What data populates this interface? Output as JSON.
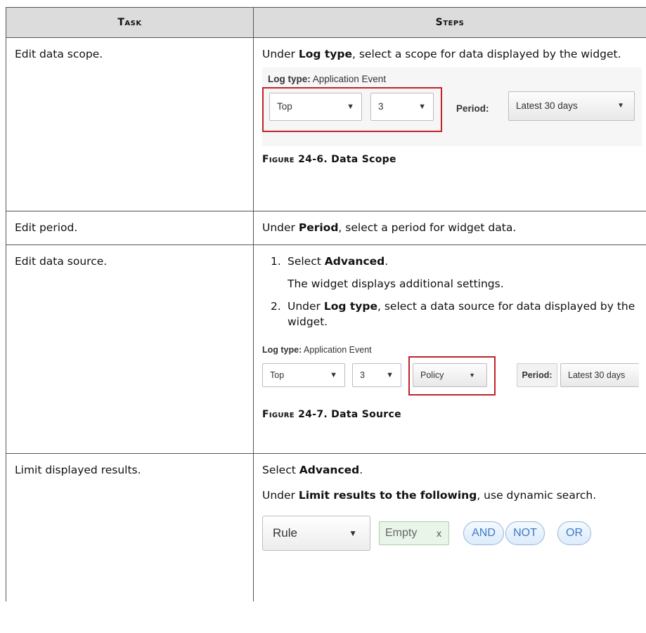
{
  "table": {
    "headers": [
      "Task",
      "Steps"
    ],
    "rows": {
      "r1": {
        "task": "Edit data scope.",
        "steps_pre": "Under ",
        "steps_bold": "Log type",
        "steps_post": ", select a scope for data displayed by the widget.",
        "figure": {
          "log_type_label": "Log type:",
          "log_type_value": " Application Event",
          "select1": "Top",
          "select2": "3",
          "period_label": "Period:",
          "period_value": "Latest 30 days",
          "caption_prefix": "Figure ",
          "caption_num": "24-6. Data Scope"
        }
      },
      "r2": {
        "task": "Edit period.",
        "steps_pre": "Under ",
        "steps_bold": "Period",
        "steps_post": ", select a period for widget data."
      },
      "r3": {
        "task": "Edit data source.",
        "step1_num": "1.",
        "step1_pre": "Select ",
        "step1_bold": "Advanced",
        "step1_post": ".",
        "step1_note": "The widget displays additional settings.",
        "step2_num": "2.",
        "step2_pre": "Under ",
        "step2_bold": "Log type",
        "step2_post": ", select a data source for data displayed by the widget.",
        "figure": {
          "log_type_label": "Log type:",
          "log_type_value": " Application Event",
          "select1": "Top",
          "select2": "3",
          "policy": "Policy",
          "period_label": "Period:",
          "period_value": "Latest 30 days",
          "caption_prefix": "Figure ",
          "caption_num": "24-7. Data Source"
        }
      },
      "r4": {
        "task": "Limit displayed results.",
        "p1_pre": "Select ",
        "p1_bold": "Advanced",
        "p1_post": ".",
        "p2_pre": "Under ",
        "p2_bold": "Limit results to the following",
        "p2_post": ", use dynamic search.",
        "figure": {
          "rule": "Rule",
          "empty": "Empty",
          "empty_close": "x",
          "and": "AND",
          "not": "NOT",
          "or": "OR"
        }
      }
    }
  },
  "colors": {
    "header_bg": "#dcdcdc",
    "highlight_border": "#c0232a",
    "pill_text": "#3d7ac7"
  }
}
